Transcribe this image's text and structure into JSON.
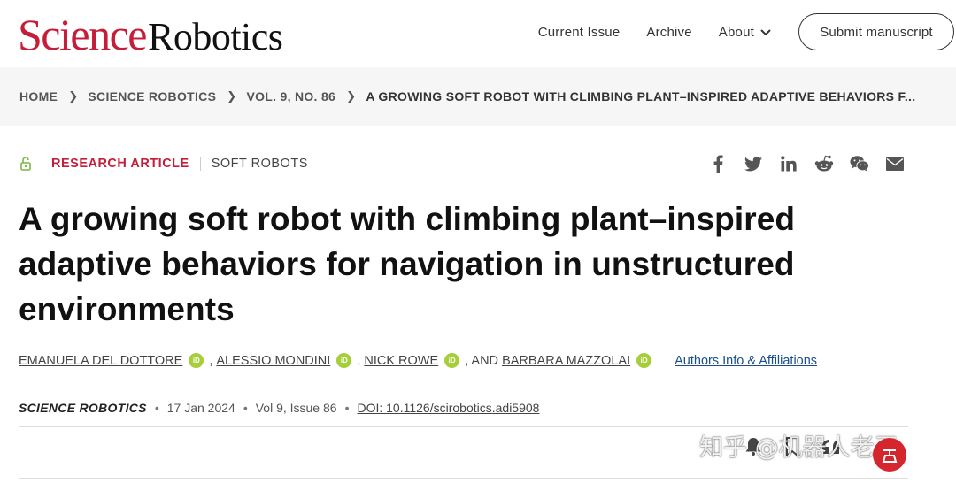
{
  "header": {
    "logo_part1": "Science",
    "logo_part2": "Robotics",
    "nav": {
      "current_issue": "Current Issue",
      "archive": "Archive",
      "about": "About"
    },
    "submit_label": "Submit manuscript"
  },
  "breadcrumb": {
    "items": [
      "HOME",
      "SCIENCE ROBOTICS",
      "VOL. 9, NO. 86"
    ],
    "current": "A GROWING SOFT ROBOT WITH CLIMBING PLANT–INSPIRED ADAPTIVE BEHAVIORS F..."
  },
  "article": {
    "type": "RESEARCH ARTICLE",
    "subject": "SOFT ROBOTS",
    "share_icons": [
      "facebook-icon",
      "twitter-icon",
      "linkedin-icon",
      "reddit-icon",
      "wechat-icon",
      "email-icon"
    ],
    "title": "A growing soft robot with climbing plant–inspired adaptive behaviors for navigation in unstructured environments",
    "authors": [
      {
        "name": "EMANUELA DEL DOTTORE",
        "prefix": ""
      },
      {
        "name": "ALESSIO MONDINI",
        "prefix": ","
      },
      {
        "name": "NICK ROWE",
        "prefix": ","
      },
      {
        "name": "BARBARA MAZZOLAI",
        "prefix": ", AND"
      }
    ],
    "orcid_label": "iD",
    "affiliations_link": "Authors Info & Affiliations",
    "journal": "SCIENCE ROBOTICS",
    "date": "17 Jan 2024",
    "issue": "Vol 9, Issue 86",
    "doi": "DOI: 10.1126/scirobotics.adi5908"
  },
  "watermark": {
    "text": "知乎 @机器人老王"
  },
  "colors": {
    "brand_red": "#c41e3a",
    "orcid_green": "#a6ce39",
    "link_blue": "#1a4e8a"
  }
}
